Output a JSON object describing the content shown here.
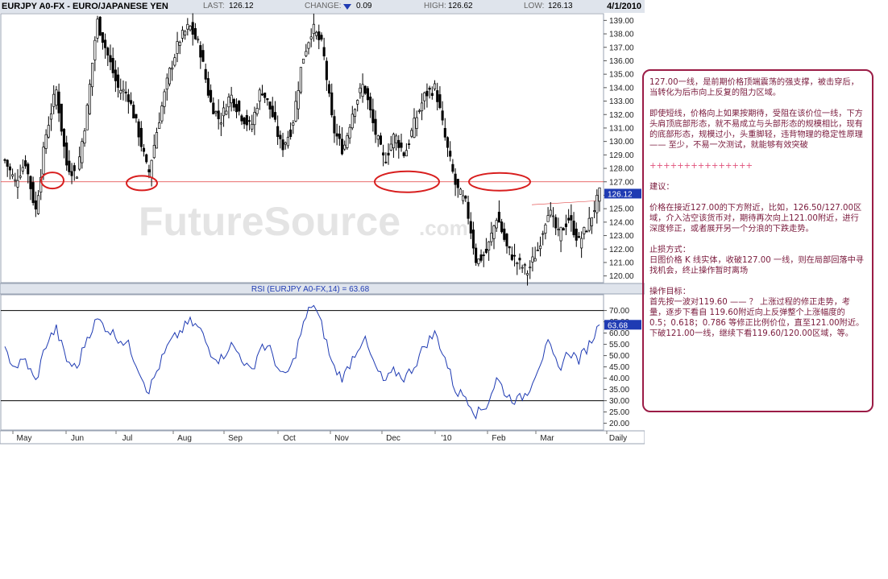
{
  "header": {
    "symbol": "EURJPY A0-FX - EURO/JAPANESE YEN",
    "last_label": "LAST:",
    "last_value": "126.12",
    "change_label": "CHANGE:",
    "change_value": "0.09",
    "high_label": "HIGH:",
    "high_value": "126.62",
    "low_label": "LOW:",
    "low_value": "126.13",
    "date": "4/1/2010"
  },
  "watermark": {
    "main": "FutureSource",
    "suffix": ".com"
  },
  "rsi_title": "RSI (EURJPY A0-FX,14) = 63.68",
  "colors": {
    "price": "#000000",
    "rsi": "#1f3bb3",
    "support_line": "#e03a3a",
    "ellipse": "#d81e1e",
    "current_box": "#1f3bb3",
    "annotation": "#7a1a3c"
  },
  "chart_data": [
    {
      "type": "candlestick",
      "title": "EURJPY A0-FX - EURO/JAPANESE YEN",
      "ylim": [
        119.5,
        139.5
      ],
      "yticks": [
        "139.00",
        "138.00",
        "137.00",
        "136.00",
        "135.00",
        "134.00",
        "133.00",
        "132.00",
        "131.00",
        "130.00",
        "129.00",
        "128.00",
        "127.00",
        "126.00",
        "125.00",
        "124.00",
        "123.00",
        "122.00",
        "121.00",
        "120.00"
      ],
      "x_labels": [
        "May",
        "Jun",
        "Jul",
        "Aug",
        "Sep",
        "Oct",
        "Nov",
        "Dec",
        "'10",
        "Feb",
        "Mar",
        "Daily"
      ],
      "current_value_label": "126.12",
      "support_level": 127.0,
      "approx_closes": [
        128.6,
        127.0,
        128.5,
        124.8,
        130.5,
        133.9,
        128.3,
        127.5,
        132.2,
        139.0,
        136.5,
        134.0,
        133.5,
        130.8,
        127.5,
        131.5,
        135.0,
        137.5,
        138.6,
        137.0,
        133.0,
        131.5,
        133.5,
        132.0,
        131.0,
        134.0,
        132.2,
        129.5,
        131.0,
        136.0,
        138.5,
        137.0,
        131.0,
        129.3,
        132.5,
        134.3,
        131.0,
        128.5,
        130.5,
        129.0,
        131.5,
        133.5,
        134.0,
        130.0,
        126.6,
        125.3,
        121.0,
        121.8,
        124.5,
        122.0,
        121.0,
        120.3,
        122.0,
        125.0,
        123.0,
        124.3,
        122.5,
        124.0,
        126.12
      ]
    },
    {
      "type": "line",
      "title": "RSI (EURJPY A0-FX,14) = 63.68",
      "ylim": [
        17,
        77
      ],
      "yticks": [
        "70.00",
        "65.00",
        "60.00",
        "55.00",
        "50.00",
        "45.00",
        "40.00",
        "35.00",
        "30.00",
        "25.00",
        "20.00"
      ],
      "reference_levels": [
        70,
        30
      ],
      "current_value_label": "63.68",
      "approx_values": [
        52,
        45,
        48,
        38,
        55,
        62,
        48,
        44,
        58,
        66,
        62,
        58,
        55,
        45,
        34,
        45,
        55,
        60,
        65,
        62,
        52,
        48,
        55,
        50,
        42,
        55,
        52,
        40,
        45,
        62,
        74,
        62,
        45,
        40,
        50,
        58,
        46,
        38,
        43,
        40,
        46,
        55,
        60,
        48,
        34,
        32,
        24,
        28,
        40,
        32,
        30,
        34,
        45,
        55,
        44,
        52,
        48,
        55,
        63.68
      ]
    }
  ],
  "annotation": {
    "p1": "127.00一线，是前期价格顶端震荡的强支撑，被击穿后，当转化为后市向上反复的阻力区域。",
    "p2": "即使短线，价格向上如果按期待，受阻在该价位一线，下方头肩顶底部形态，就不易成立与头部形态的规模相比，现有的底部形态，规模过小，头重脚轻，违背物理的稳定性原理—— 至少，不易一次测试，就能够有效突破",
    "plus": "+++++++++++++++",
    "p3": "建议：",
    "p4": "价格在接近127.00的下方附近，比如，126.50/127.00区域，介入沽空该货币对，期待再次向上121.00附近，进行深度修正，或者展开另一个分浪的下跌走势。",
    "p5": "止损方式：",
    "p6": "日图价格 K 线实体，收破127.00 一线，则在局部回落中寻找机会，终止操作暂时离场",
    "p7": "操作目标：",
    "p8": "首先按一波对119.60 —— ？ 上涨过程的修正走势，考量，逐步下看自 119.60附近向上反弹整个上涨幅度的0.5；0.618；0.786 等修正比例价位，直至121.00附近。下破121.00一线，继续下看119.60/120.00区域，等。"
  }
}
